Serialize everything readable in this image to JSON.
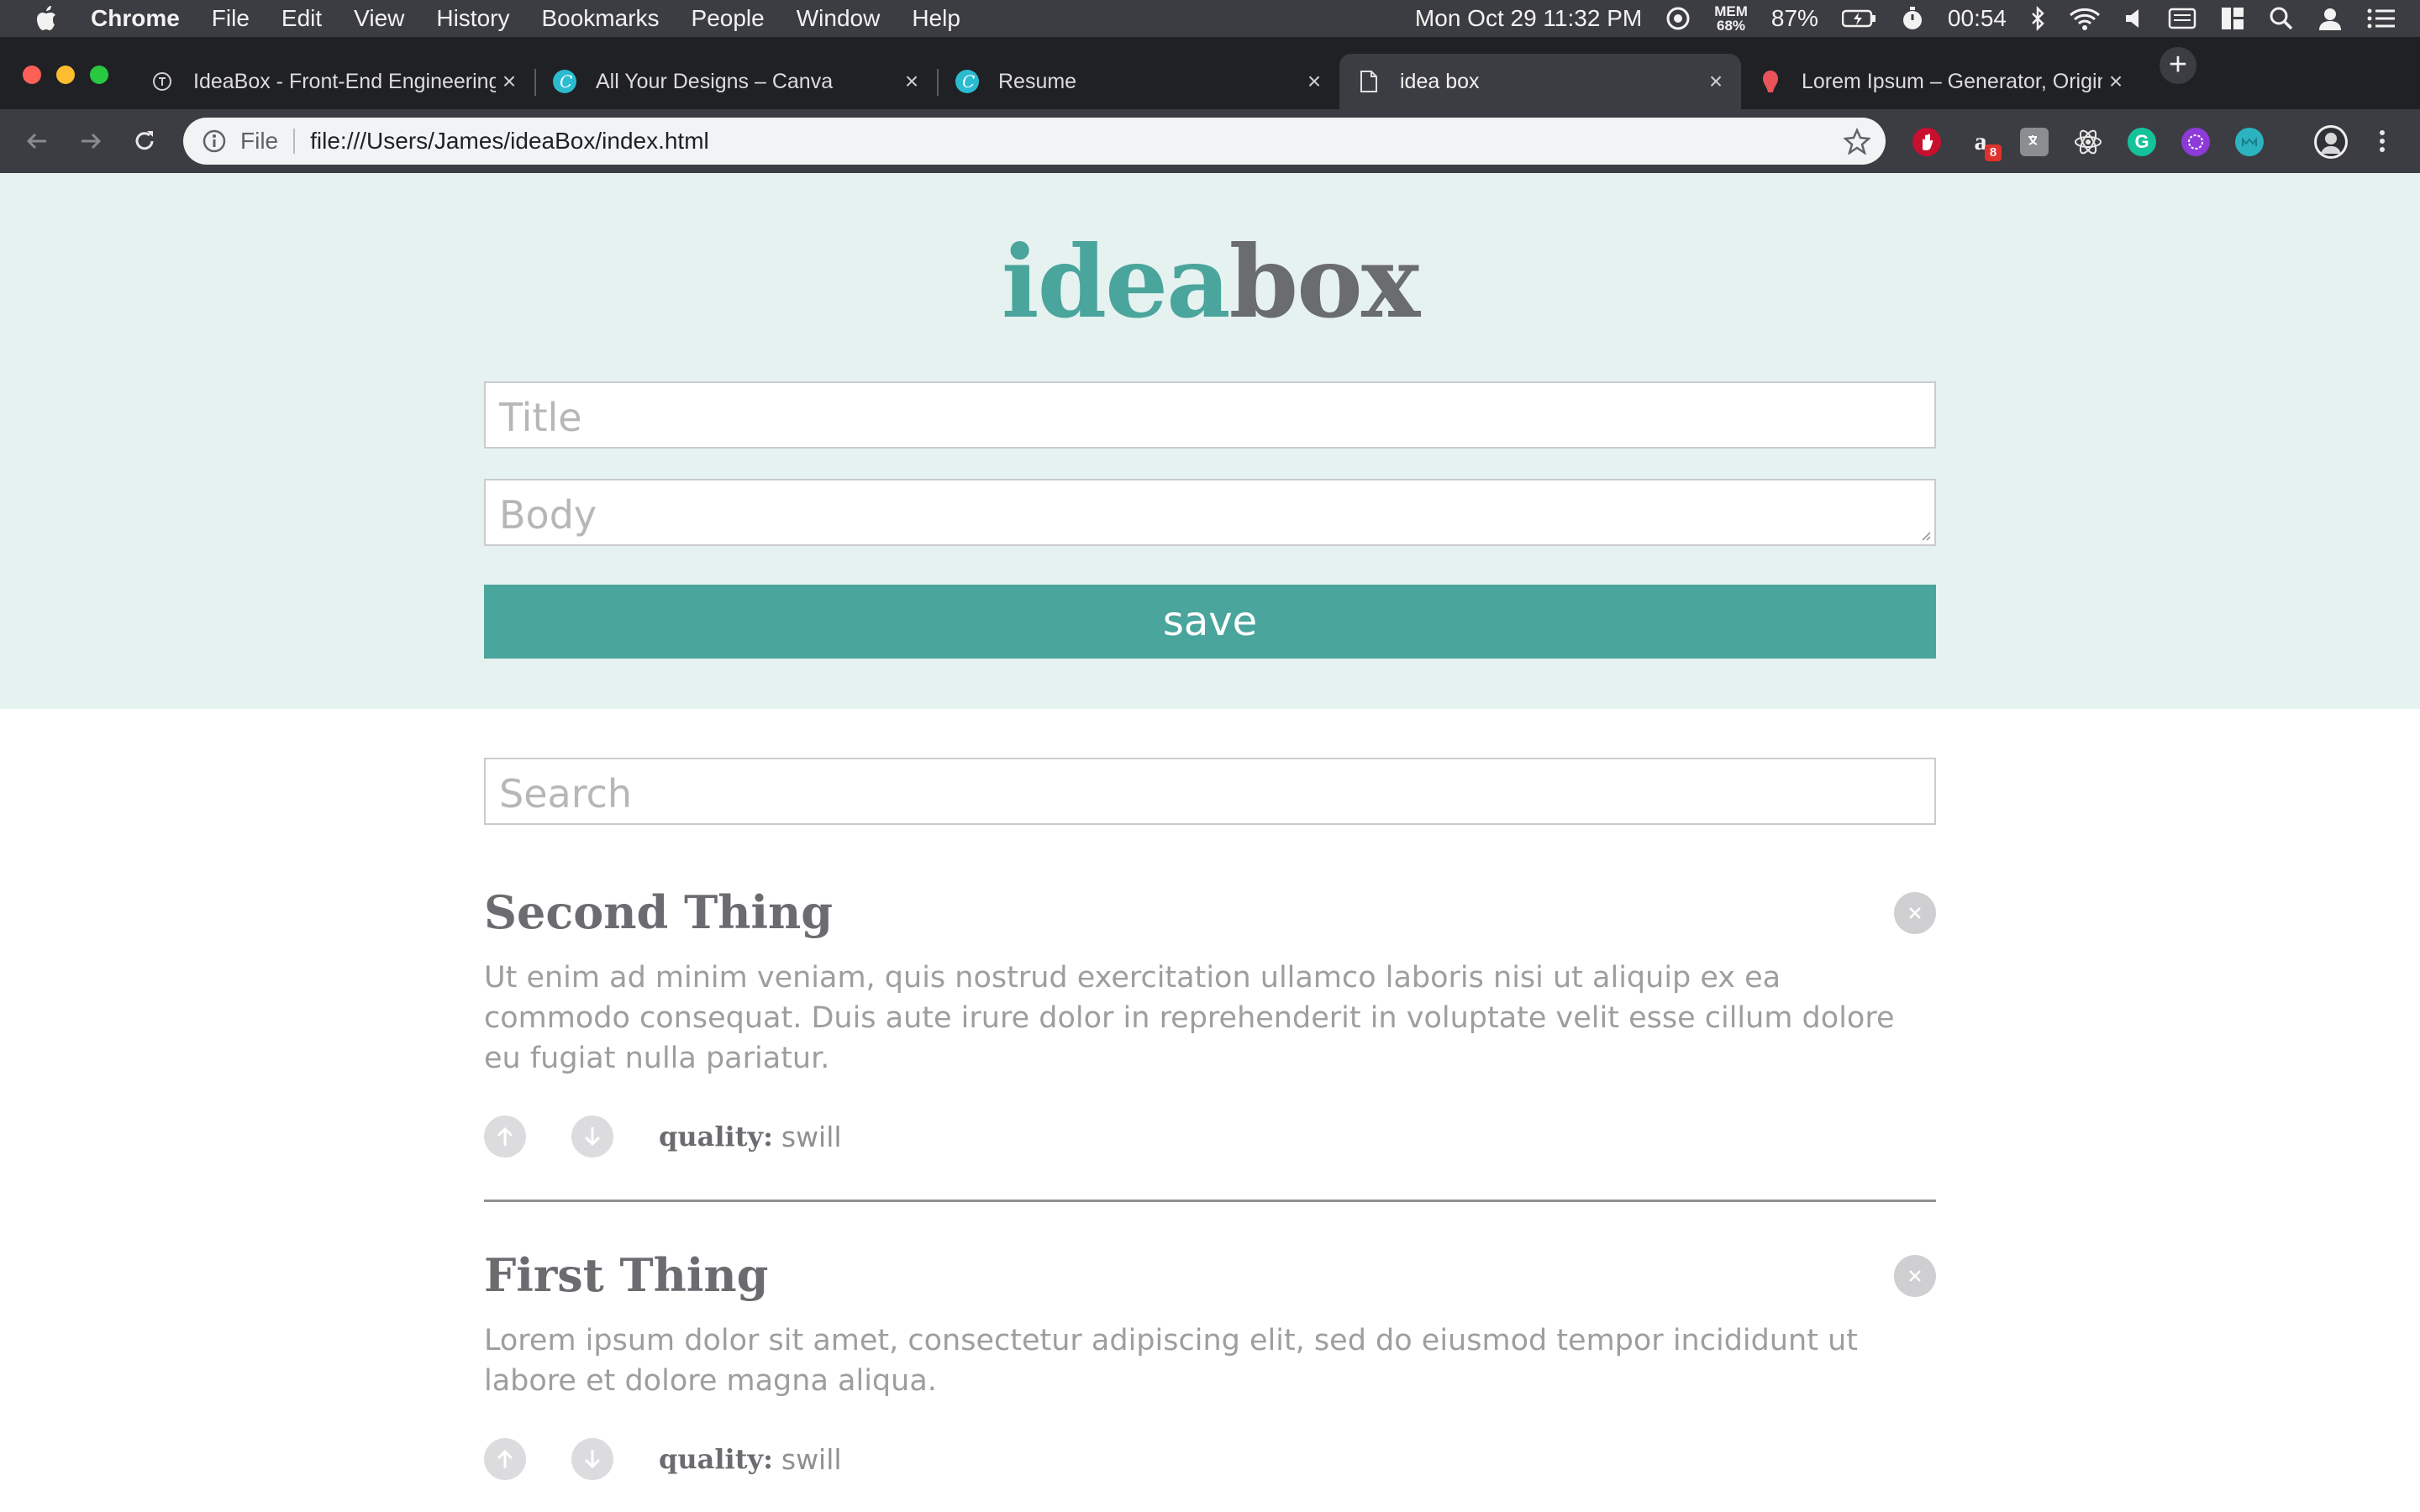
{
  "menubar": {
    "app_name": "Chrome",
    "items": [
      "File",
      "Edit",
      "View",
      "History",
      "Bookmarks",
      "People",
      "Window",
      "Help"
    ],
    "datetime": "Mon Oct 29  11:32 PM",
    "mem_label": "MEM",
    "mem_value": "68%",
    "battery": "87%",
    "timer": "00:54"
  },
  "tabs": [
    {
      "title": "IdeaBox - Front-End Engineering",
      "icon": "turing-icon"
    },
    {
      "title": "All Your Designs – Canva",
      "icon": "canva-icon"
    },
    {
      "title": "Resume",
      "icon": "canva-icon"
    },
    {
      "title": "idea box",
      "icon": "document-icon",
      "active": true
    },
    {
      "title": "Lorem Ipsum – Generator, Origins",
      "icon": "lorem-icon"
    }
  ],
  "omnibox": {
    "scheme_label": "File",
    "url": "file:///Users/James/ideaBox/index.html"
  },
  "extensions": {
    "badge_count": "8",
    "amazon_letter": "a"
  },
  "app": {
    "logo_part1": "idea",
    "logo_part2": "box",
    "title_placeholder": "Title",
    "body_placeholder": "Body",
    "save_label": "save",
    "search_placeholder": "Search",
    "quality_label": "quality:"
  },
  "ideas": [
    {
      "title": "Second Thing",
      "body": "Ut enim ad minim veniam, quis nostrud exercitation ullamco laboris nisi ut aliquip ex ea commodo consequat. Duis aute irure dolor in reprehenderit in voluptate velit esse cillum dolore eu fugiat nulla pariatur.",
      "quality": "swill"
    },
    {
      "title": "First Thing",
      "body": "Lorem ipsum dolor sit amet, consectetur adipiscing elit, sed do eiusmod tempor incididunt ut labore et dolore magna aliqua.",
      "quality": "swill"
    }
  ],
  "colors": {
    "accent": "#4aa59c",
    "logo_gray": "#6b6c70",
    "hero_bg": "#e5f2f0"
  }
}
